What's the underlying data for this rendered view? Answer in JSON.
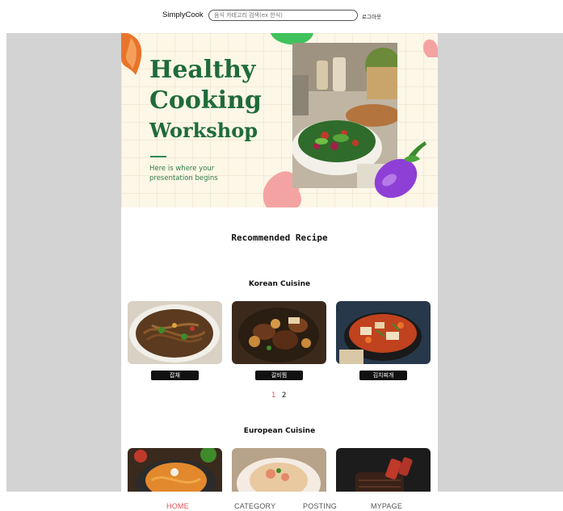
{
  "header": {
    "brand": "SimplyCook",
    "search_placeholder": "음식 카테고리 검색(ex 한식)",
    "login_label": "로그아웃"
  },
  "banner": {
    "title_line1": "Healthy",
    "title_line2": "Cooking",
    "title_line3": "Workshop",
    "subtitle": "Here is where your presentation begins"
  },
  "recommended": {
    "title": "Recommended Recipe"
  },
  "korean": {
    "title": "Korean Cuisine",
    "dishes": [
      {
        "label": "잡채"
      },
      {
        "label": "갈비찜"
      },
      {
        "label": "김치찌개"
      }
    ],
    "pages": [
      "1",
      "2"
    ],
    "current_page": "1"
  },
  "european": {
    "title": "European Cuisine"
  },
  "nav": {
    "items": [
      "HOME",
      "CATEGORY",
      "POSTING",
      "MYPAGE"
    ],
    "active": "HOME"
  },
  "colors": {
    "accent": "#e8505b",
    "banner_green": "#1f6b3a",
    "stage_gray": "#d3d3d3"
  }
}
